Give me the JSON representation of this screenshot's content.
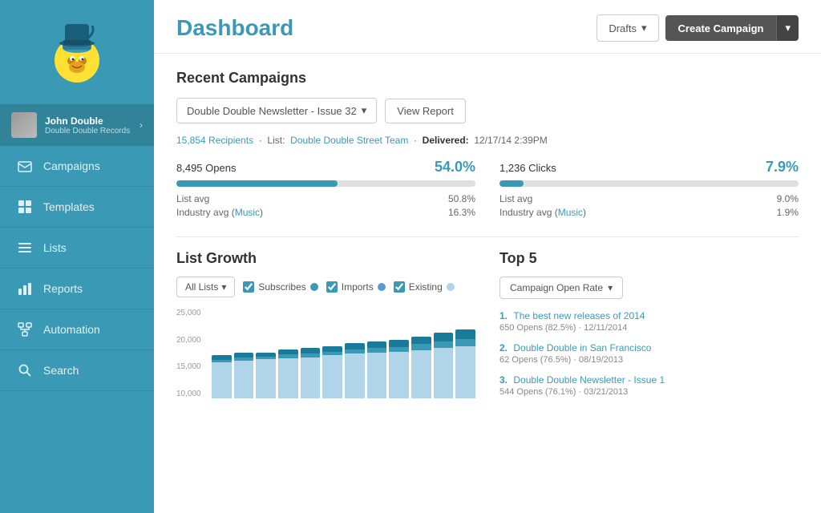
{
  "sidebar": {
    "logo_alt": "MailChimp",
    "user": {
      "name": "John Double",
      "subtitle": "Double Double Records",
      "chevron": "›"
    },
    "nav_items": [
      {
        "id": "campaigns",
        "label": "Campaigns",
        "icon": "envelope"
      },
      {
        "id": "templates",
        "label": "Templates",
        "icon": "grid"
      },
      {
        "id": "lists",
        "label": "Lists",
        "icon": "list"
      },
      {
        "id": "reports",
        "label": "Reports",
        "icon": "bar-chart"
      },
      {
        "id": "automation",
        "label": "Automation",
        "icon": "automation"
      },
      {
        "id": "search",
        "label": "Search",
        "icon": "search"
      }
    ]
  },
  "header": {
    "title": "Dashboard",
    "drafts_label": "Drafts",
    "create_label": "Create Campaign"
  },
  "recent_campaigns": {
    "section_title": "Recent Campaigns",
    "campaign_name": "Double Double Newsletter - Issue 32",
    "view_report_label": "View Report",
    "meta": {
      "recipients": "15,854 Recipients",
      "list_label": "List:",
      "list_name": "Double Double Street Team",
      "delivered_label": "Delivered:",
      "delivered": "12/17/14 2:39PM"
    },
    "opens": {
      "label": "8,495 Opens",
      "pct": "54.0%",
      "fill_pct": 54,
      "list_avg_label": "List avg",
      "list_avg": "50.8%",
      "industry_label": "Industry avg",
      "industry_link": "Music",
      "industry_avg": "16.3%"
    },
    "clicks": {
      "label": "1,236 Clicks",
      "pct": "7.9%",
      "fill_pct": 7.9,
      "list_avg_label": "List avg",
      "list_avg": "9.0%",
      "industry_label": "Industry avg",
      "industry_link": "Music",
      "industry_avg": "1.9%"
    }
  },
  "list_growth": {
    "title": "List Growth",
    "filter_label": "All Lists",
    "subscribes_label": "Subscribes",
    "imports_label": "Imports",
    "existing_label": "Existing",
    "y_labels": [
      "25,000",
      "20,000",
      "15,000",
      "10,000"
    ],
    "bars": [
      {
        "sub": 1200,
        "imp": 800,
        "ex": 10000
      },
      {
        "sub": 1300,
        "imp": 900,
        "ex": 10500
      },
      {
        "sub": 1100,
        "imp": 700,
        "ex": 11000
      },
      {
        "sub": 1400,
        "imp": 1000,
        "ex": 11200
      },
      {
        "sub": 1500,
        "imp": 1100,
        "ex": 11500
      },
      {
        "sub": 1600,
        "imp": 1000,
        "ex": 12000
      },
      {
        "sub": 1700,
        "imp": 1200,
        "ex": 12500
      },
      {
        "sub": 1800,
        "imp": 1300,
        "ex": 12800
      },
      {
        "sub": 2000,
        "imp": 1400,
        "ex": 13000
      },
      {
        "sub": 2200,
        "imp": 1600,
        "ex": 13500
      },
      {
        "sub": 2400,
        "imp": 1800,
        "ex": 14000
      },
      {
        "sub": 2600,
        "imp": 2000,
        "ex": 14500
      }
    ]
  },
  "top5": {
    "title": "Top 5",
    "dropdown_label": "Campaign Open Rate",
    "items": [
      {
        "num": "1.",
        "title": "The best new releases of 2014",
        "meta": "650 Opens (82.5%) · 12/11/2014"
      },
      {
        "num": "2.",
        "title": "Double Double in San Francisco",
        "meta": "62 Opens (76.5%) · 08/19/2013"
      },
      {
        "num": "3.",
        "title": "Double Double Newsletter - Issue 1",
        "meta": "544 Opens (76.1%) · 03/21/2013"
      }
    ]
  }
}
